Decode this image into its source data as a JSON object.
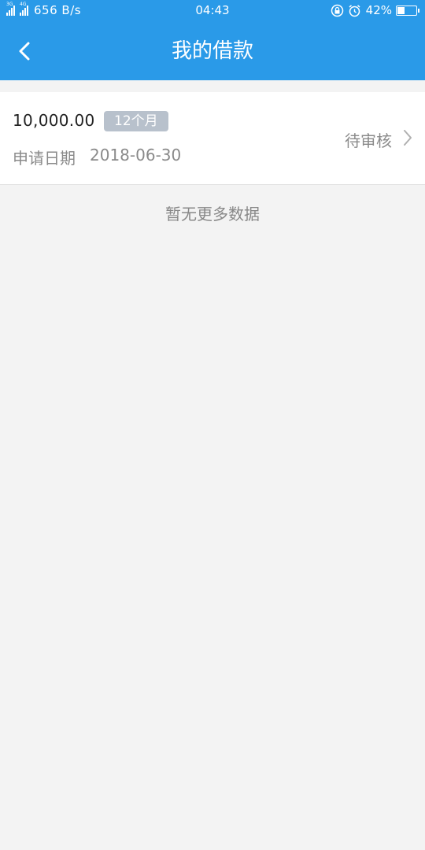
{
  "status_bar": {
    "sim1_label": "3G",
    "sim2_label": "4G",
    "net_speed": "656 B/s",
    "time": "04:43",
    "battery_percent": "42%",
    "battery_level": 0.42,
    "icons": [
      "rotation-lock-icon",
      "alarm-icon",
      "battery-icon"
    ]
  },
  "nav": {
    "title": "我的借款",
    "back_icon": "chevron-left-icon"
  },
  "loans": [
    {
      "amount": "10,000.00",
      "term": "12个月",
      "date_label": "申请日期",
      "date": "2018-06-30",
      "status": "待审核"
    }
  ],
  "footer_text": "暂无更多数据",
  "colors": {
    "primary": "#2a9ae8",
    "background": "#f3f3f3",
    "badge": "#b8c1cc"
  }
}
